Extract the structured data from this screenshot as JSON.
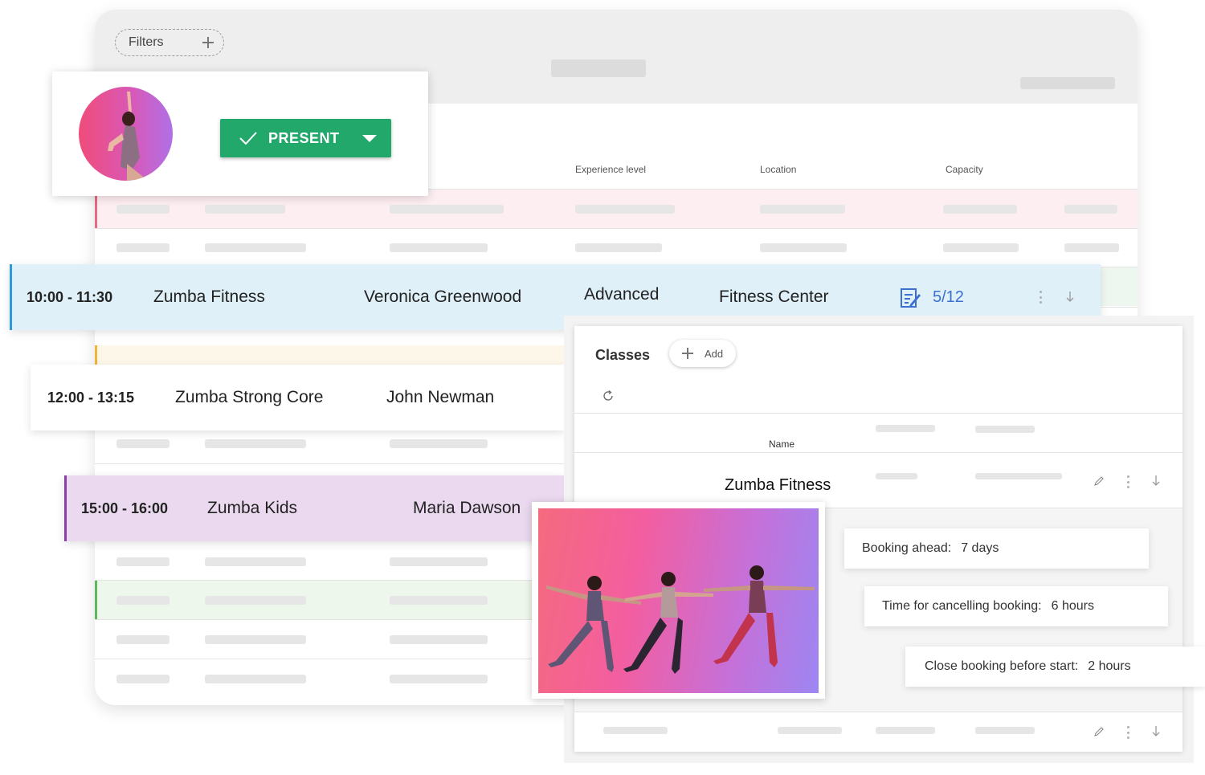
{
  "filters": {
    "label": "Filters"
  },
  "table": {
    "columns": {
      "experience": "Experience level",
      "location": "Location",
      "capacity": "Capacity"
    }
  },
  "attendance": {
    "status_label": "PRESENT",
    "status_color": "#22a86b"
  },
  "sessions": [
    {
      "time": "10:00 - 11:30",
      "class": "Zumba Fitness",
      "instructor": "Veronica Greenwood",
      "level": "Advanced",
      "location": "Fitness Center",
      "capacity": "5/12",
      "accent": "#2e9bd6"
    },
    {
      "time": "12:00 - 13:15",
      "class": "Zumba Strong Core",
      "instructor": "John Newman"
    },
    {
      "time": "15:00 - 16:00",
      "class": "Zumba Kids",
      "instructor": "Maria Dawson",
      "accent": "#8a3fa8"
    }
  ],
  "classes_panel": {
    "title": "Classes",
    "add_label": "Add",
    "name_column": "Name",
    "selected_class": "Zumba Fitness",
    "booking": [
      {
        "label": "Booking ahead:",
        "value": "7 days"
      },
      {
        "label": "Time for cancelling booking:",
        "value": "6 hours"
      },
      {
        "label": "Close booking before start:",
        "value": "2 hours"
      }
    ]
  },
  "icons": [
    "plus-icon",
    "check-icon",
    "caret-down-icon",
    "notes-icon",
    "kebab-icon",
    "arrow-down-icon",
    "refresh-icon",
    "pencil-icon"
  ]
}
